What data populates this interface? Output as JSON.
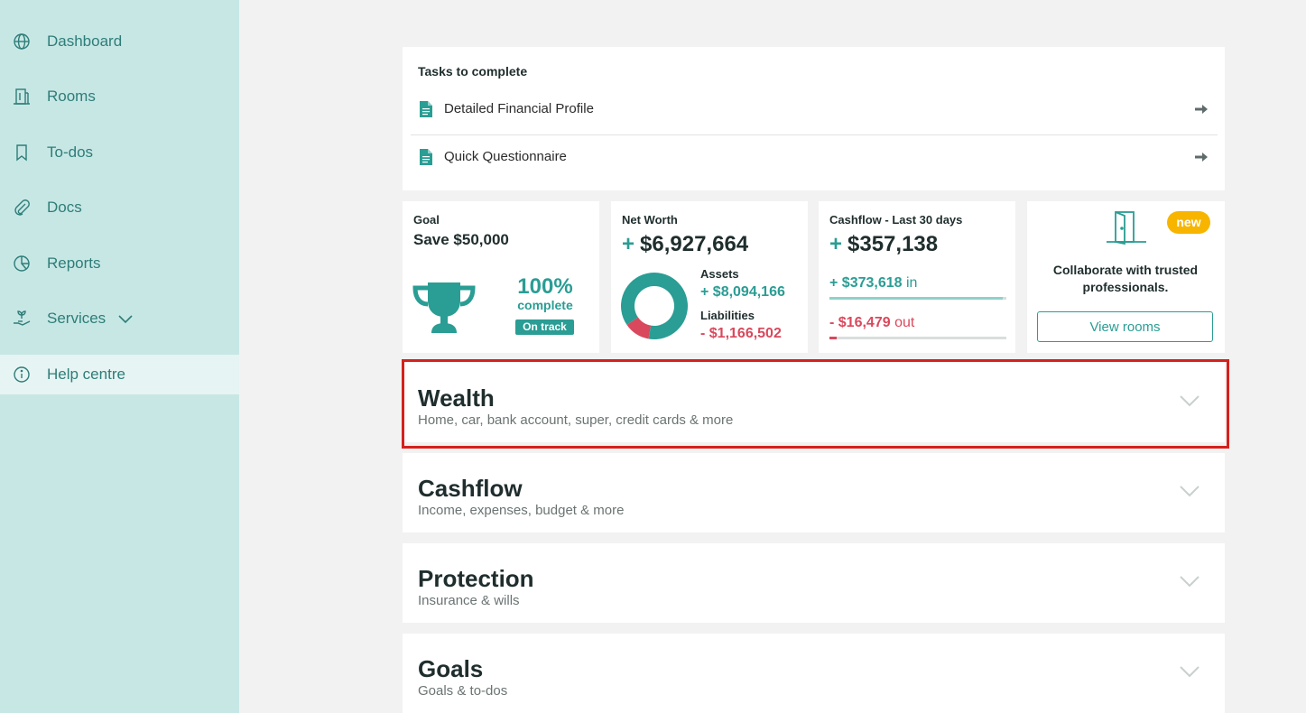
{
  "sidebar": {
    "items": [
      {
        "label": "Dashboard",
        "icon": "globe-icon"
      },
      {
        "label": "Rooms",
        "icon": "building-icon"
      },
      {
        "label": "To-dos",
        "icon": "bookmark-icon"
      },
      {
        "label": "Docs",
        "icon": "paperclip-icon"
      },
      {
        "label": "Reports",
        "icon": "pie-chart-icon"
      },
      {
        "label": "Services",
        "icon": "hand-plant-icon"
      },
      {
        "label": "Help centre",
        "icon": "info-icon"
      }
    ],
    "active_item": "Help centre"
  },
  "tasks": {
    "title": "Tasks to complete",
    "items": [
      {
        "label": "Detailed Financial Profile"
      },
      {
        "label": "Quick Questionnaire"
      }
    ]
  },
  "goal": {
    "label": "Goal",
    "name": "Save $50,000",
    "percent": "100%",
    "percent_label": "complete",
    "status": "On track"
  },
  "net_worth": {
    "label": "Net Worth",
    "sign": "+",
    "value": "$6,927,664",
    "assets_label": "Assets",
    "assets_value": "+ $8,094,166",
    "liabilities_label": "Liabilities",
    "liabilities_value": "- $1,166,502",
    "assets_amount": 8094166,
    "liabilities_amount": 1166502
  },
  "cashflow": {
    "label": "Cashflow - Last 30 days",
    "sign": "+",
    "value": "$357,138",
    "in_value": "+ $373,618",
    "in_label": "in",
    "out_value": "- $16,479",
    "out_label": "out",
    "in_fraction": 0.98,
    "out_fraction": 0.04
  },
  "rooms_card": {
    "badge": "new",
    "text": "Collaborate with trusted professionals.",
    "button": "View rooms"
  },
  "sections": [
    {
      "title": "Wealth",
      "subtitle": "Home, car, bank account, super, credit cards & more"
    },
    {
      "title": "Cashflow",
      "subtitle": "Income, expenses, budget & more"
    },
    {
      "title": "Protection",
      "subtitle": "Insurance & wills"
    },
    {
      "title": "Goals",
      "subtitle": "Goals & to-dos"
    }
  ],
  "colors": {
    "sidebar_bg": "#c7e7e5",
    "accent": "#2a9d94",
    "negative": "#d9485c",
    "badge": "#f7b500",
    "highlight": "#d6201c"
  }
}
